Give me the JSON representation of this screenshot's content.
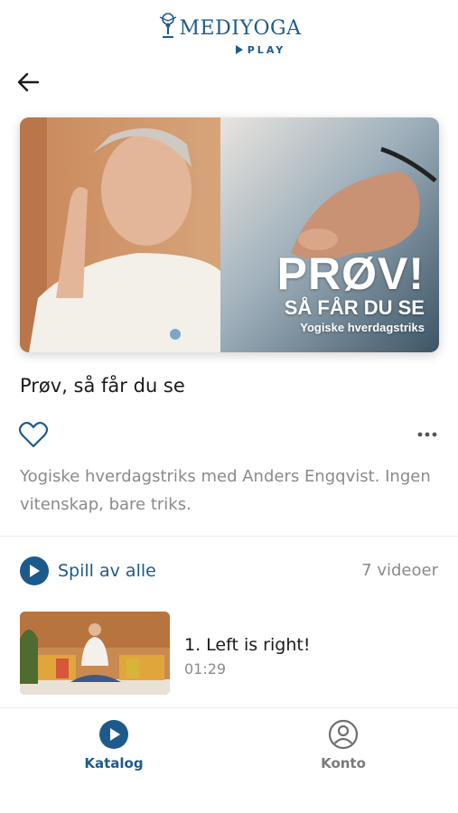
{
  "header": {
    "logo_main": "MEDIYOGA",
    "logo_sub": "PLAY",
    "back_icon": "arrow-left-icon"
  },
  "hero": {
    "headline": "PRØV!",
    "subheadline": "SÅ FÅR DU SE",
    "tagline": "Yogiske hverdagstriks"
  },
  "program": {
    "title": "Prøv, så får du se",
    "description": "Yogiske hverdagstriks med Anders Engqvist. Ingen vitenskap, bare triks.",
    "favorite_icon": "heart-outline-icon",
    "more_icon": "more-horizontal-icon"
  },
  "playlist": {
    "play_all_label": "Spill av alle",
    "video_count": "7 videoer",
    "videos": [
      {
        "title": "1. Left is right!",
        "duration": "01:29"
      }
    ]
  },
  "tabbar": {
    "tabs": [
      {
        "label": "Katalog",
        "icon": "play-circle-icon",
        "active": true
      },
      {
        "label": "Konto",
        "icon": "user-circle-icon",
        "active": false
      }
    ]
  },
  "colors": {
    "brand": "#1d5a8c",
    "muted_text": "#8a8a8a"
  }
}
